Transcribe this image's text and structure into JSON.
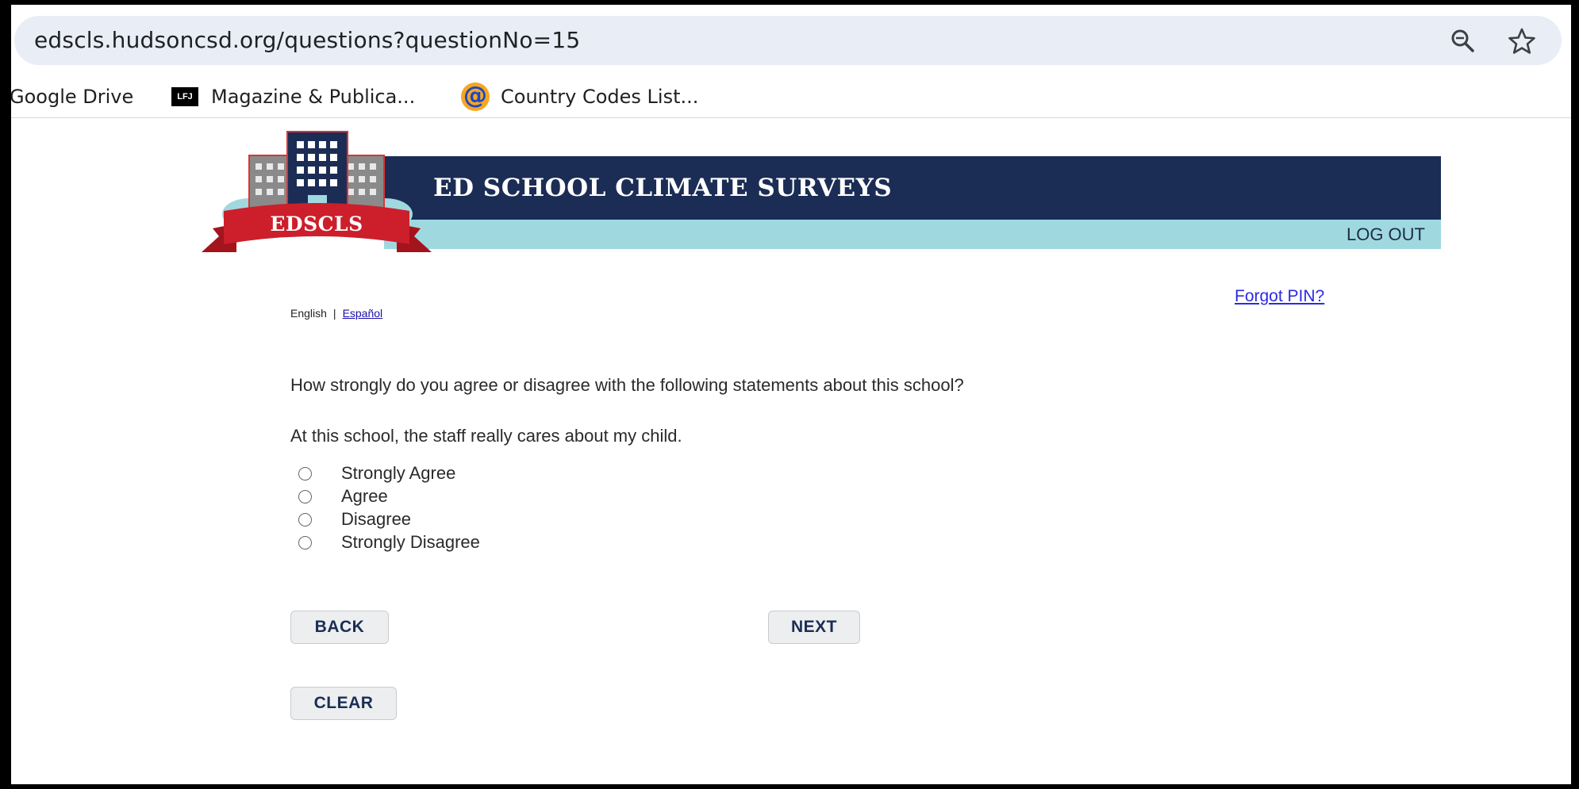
{
  "browser": {
    "url": "edscls.hudsoncsd.org/questions?questionNo=15",
    "bookmarks": [
      {
        "label": "Google Drive"
      },
      {
        "label": "Magazine & Publica...",
        "icon_text": "LFJ"
      },
      {
        "label": "Country Codes List...",
        "icon_text": "@"
      }
    ]
  },
  "header": {
    "logo_text": "EDSCLS",
    "title": "ED SCHOOL CLIMATE SURVEYS",
    "logout_label": "LOG OUT",
    "colors": {
      "banner": "#1b2d55",
      "subbar": "#9fd9df",
      "ribbon": "#cc1f2b"
    }
  },
  "language": {
    "current": "English",
    "separator": "|",
    "alternate": "Español"
  },
  "forgot_pin": "Forgot PIN?",
  "question": {
    "prompt": "How strongly do you agree or disagree with the following statements about this school?",
    "statement": "At this school, the staff really cares about my child.",
    "options": [
      "Strongly Agree",
      "Agree",
      "Disagree",
      "Strongly Disagree"
    ]
  },
  "buttons": {
    "back": "BACK",
    "next": "NEXT",
    "clear": "CLEAR"
  }
}
